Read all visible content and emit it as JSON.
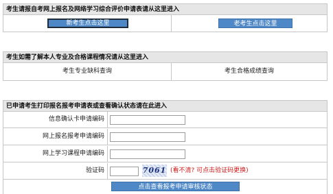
{
  "section1": {
    "title": "考生请报自考网上报名及网络学习综合评价申请表请从这里进入",
    "new_btn": "新考生点击这里",
    "old_btn": "老考生点击这里"
  },
  "section2": {
    "title": "考生如需了解本人专业及合格课程情况请从这里进入",
    "link_left": "考生专业缺科查询",
    "link_right": "考生合格成绩查询"
  },
  "section3": {
    "title": "已申请考生打印报名报考申请表或查看确认状态请在此进入",
    "fields": [
      {
        "label": "信息确认卡申请编码",
        "value": ""
      },
      {
        "label": "网上报名报考申请编码",
        "value": ""
      },
      {
        "label": "网上学习课程申请编码",
        "value": ""
      }
    ],
    "captcha_label": "验证码",
    "captcha_value": "",
    "captcha_text": "7061",
    "captcha_hint": "(看不清? 可点击验证码更换)",
    "submit_btn": "点击查看报考申请审核状态"
  }
}
